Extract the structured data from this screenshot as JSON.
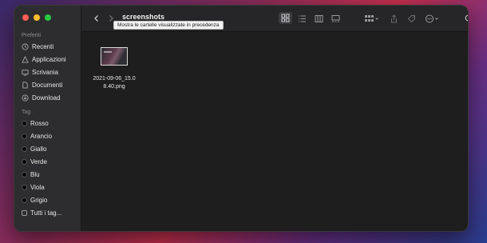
{
  "window": {
    "title": "screenshots",
    "tooltip": "Mostra le cartelle visualizzate in precedenza"
  },
  "sidebar": {
    "favorites_label": "Preferiti",
    "favorites": [
      {
        "label": "Recenti",
        "icon": "clock-icon"
      },
      {
        "label": "Applicazioni",
        "icon": "apps-icon"
      },
      {
        "label": "Scrivania",
        "icon": "desktop-icon"
      },
      {
        "label": "Documenti",
        "icon": "document-icon"
      },
      {
        "label": "Download",
        "icon": "download-icon"
      }
    ],
    "tags_label": "Tag",
    "tags": [
      {
        "label": "Rosso"
      },
      {
        "label": "Arancio"
      },
      {
        "label": "Giallo"
      },
      {
        "label": "Verde"
      },
      {
        "label": "Blu"
      },
      {
        "label": "Viola"
      },
      {
        "label": "Grigio"
      },
      {
        "label": "Tutti i tag..."
      }
    ]
  },
  "files": [
    {
      "name_line1": "2021-09-06_15.0",
      "name_line2": "8.40.png"
    }
  ],
  "colors": {
    "window_bg": "#1e1e1e",
    "sidebar_bg": "#2d2d2f",
    "close": "#fe5f57",
    "minimize": "#febc2e",
    "maximize": "#28c840"
  }
}
